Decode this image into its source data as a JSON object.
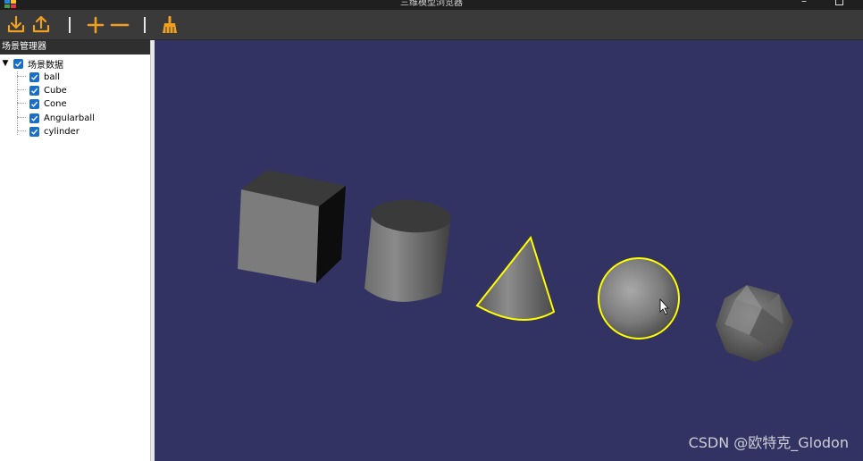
{
  "window": {
    "title": "三维模型浏览器",
    "minimize_label": "–"
  },
  "toolbar": {
    "buttons": [
      {
        "name": "import-icon"
      },
      {
        "name": "export-icon"
      },
      {
        "name": "add-icon"
      },
      {
        "name": "remove-icon"
      },
      {
        "name": "clear-broom-icon"
      }
    ],
    "accent_color": "#f0a020"
  },
  "scene_panel": {
    "title": "场景管理器",
    "root": {
      "label": "场景数据",
      "checked": true,
      "expanded": true
    },
    "items": [
      {
        "label": "ball",
        "checked": true
      },
      {
        "label": "Cube",
        "checked": true
      },
      {
        "label": "Cone",
        "checked": true
      },
      {
        "label": "Angularball",
        "checked": true
      },
      {
        "label": "cylinder",
        "checked": true
      }
    ]
  },
  "viewport": {
    "background_color": "#333363",
    "highlight_color": "#ffff00",
    "objects": [
      "cube",
      "cylinder",
      "cone",
      "ball",
      "angularball"
    ],
    "selected": [
      "cone",
      "ball"
    ]
  },
  "watermark": "CSDN @欧特克_Glodon"
}
